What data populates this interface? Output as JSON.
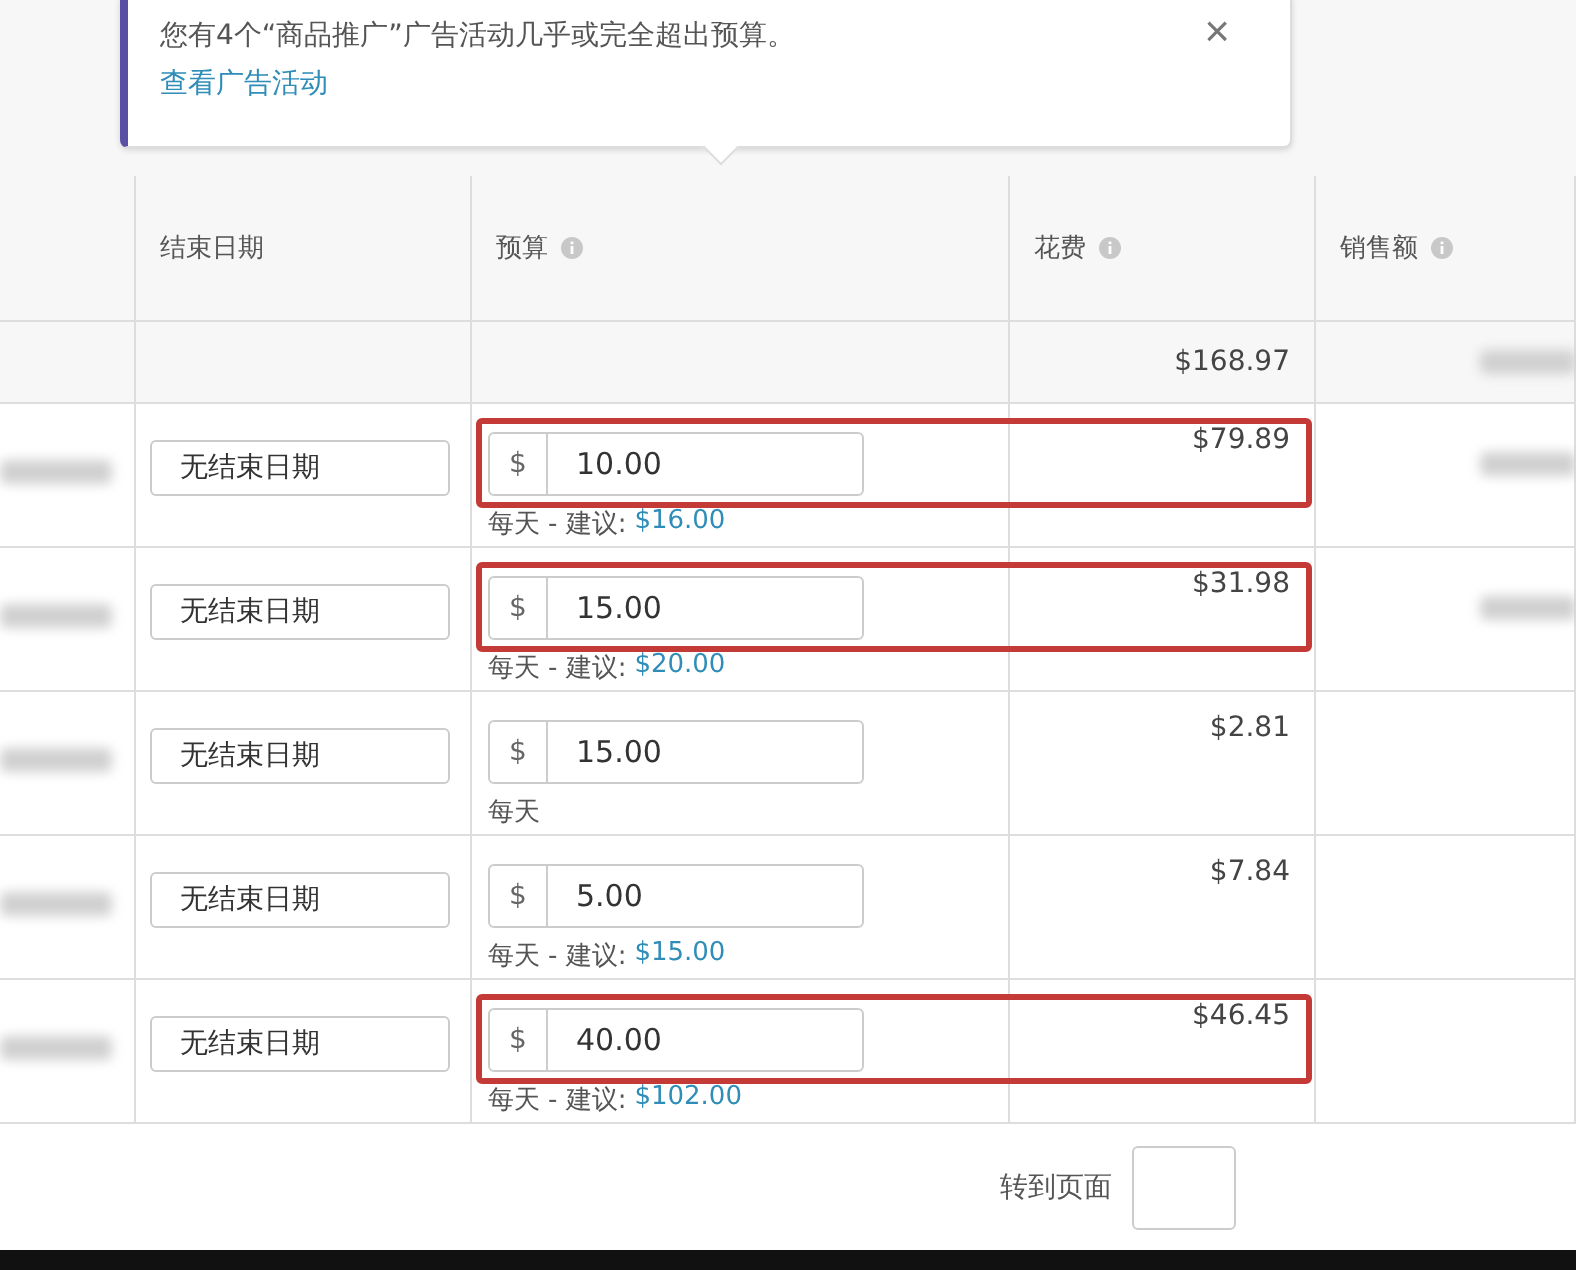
{
  "notice": {
    "message": "您有4个“商品推广”广告活动几乎或完全超出预算。",
    "link": "查看广告活动",
    "close": "×"
  },
  "table": {
    "columns": [
      {
        "label": "结束日期",
        "info": false
      },
      {
        "label": "预算",
        "info": true
      },
      {
        "label": "花费",
        "info": true
      },
      {
        "label": "销售额",
        "info": true
      }
    ],
    "total": {
      "spend": "$168.97",
      "sales_blurred": true
    },
    "rows": [
      {
        "name_blurred": true,
        "end_date": "无结束日期",
        "currency": "$",
        "budget": "10.00",
        "period": "每天",
        "suggestion_label": "- 建议:",
        "suggestion": "$16.00",
        "spend": "$79.89",
        "sales_blurred": true,
        "highlighted": true
      },
      {
        "name_blurred": true,
        "end_date": "无结束日期",
        "currency": "$",
        "budget": "15.00",
        "period": "每天",
        "suggestion_label": "- 建议:",
        "suggestion": "$20.00",
        "spend": "$31.98",
        "sales_blurred": true,
        "highlighted": true
      },
      {
        "name_blurred": true,
        "end_date": "无结束日期",
        "currency": "$",
        "budget": "15.00",
        "period": "每天",
        "spend": "$2.81",
        "sales_blurred": false,
        "highlighted": false
      },
      {
        "name_blurred": true,
        "end_date": "无结束日期",
        "currency": "$",
        "budget": "5.00",
        "period": "每天",
        "suggestion_label": "- 建议:",
        "suggestion": "$15.00",
        "spend": "$7.84",
        "sales_blurred": false,
        "highlighted": false
      },
      {
        "name_blurred": true,
        "end_date": "无结束日期",
        "currency": "$",
        "budget": "40.00",
        "period": "每天",
        "suggestion_label": "- 建议:",
        "suggestion": "$102.00",
        "spend": "$46.45",
        "sales_blurred": false,
        "highlighted": true
      }
    ]
  },
  "pagination": {
    "label": "转到页面"
  }
}
